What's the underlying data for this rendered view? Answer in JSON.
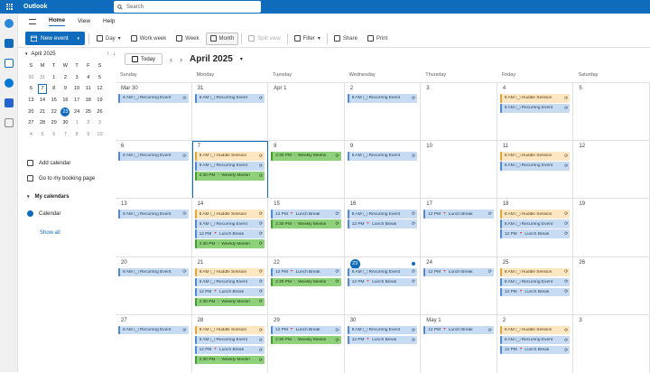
{
  "app": {
    "title": "Outlook",
    "search_placeholder": "Search"
  },
  "ribbon": {
    "tabs": [
      "Home",
      "View",
      "Help"
    ],
    "active": "Home"
  },
  "toolbar": {
    "new_event": "New event",
    "buttons": [
      {
        "label": "Day",
        "icon": "day-icon",
        "state": "normal",
        "name": "day-view-button"
      },
      {
        "label": "Work week",
        "icon": "workweek-icon",
        "state": "normal",
        "name": "workweek-view-button"
      },
      {
        "label": "Week",
        "icon": "week-icon",
        "state": "normal",
        "name": "week-view-button"
      },
      {
        "label": "Month",
        "icon": "month-icon",
        "state": "active",
        "name": "month-view-button"
      },
      {
        "label": "Split view",
        "icon": "split-icon",
        "state": "disabled",
        "name": "split-view-button"
      },
      {
        "label": "Filter",
        "icon": "filter-icon",
        "state": "normal",
        "name": "filter-button"
      },
      {
        "label": "Share",
        "icon": "share-icon",
        "state": "normal",
        "name": "share-button"
      },
      {
        "label": "Print",
        "icon": "print-icon",
        "state": "normal",
        "name": "print-button"
      }
    ]
  },
  "minical": {
    "title": "April 2025",
    "dow": [
      "S",
      "M",
      "T",
      "W",
      "T",
      "F",
      "S"
    ],
    "weeks": [
      [
        "30",
        "31",
        "1",
        "2",
        "3",
        "4",
        "5"
      ],
      [
        "6",
        "7",
        "8",
        "9",
        "10",
        "11",
        "12"
      ],
      [
        "13",
        "14",
        "15",
        "16",
        "17",
        "18",
        "19"
      ],
      [
        "20",
        "21",
        "22",
        "23",
        "24",
        "25",
        "26"
      ],
      [
        "27",
        "28",
        "29",
        "30",
        "1",
        "2",
        "3"
      ],
      [
        "4",
        "5",
        "6",
        "7",
        "8",
        "9",
        "10"
      ]
    ],
    "today": "23",
    "selected": "7"
  },
  "sidebar": {
    "add_calendar": "Add calendar",
    "booking": "Go to my booking page",
    "my_calendars": "My calendars",
    "calendar": "Calendar",
    "show_all": "Show all"
  },
  "calendar": {
    "today_label": "Today",
    "month_title": "April 2025",
    "dow": [
      "Sunday",
      "Monday",
      "Tuesday",
      "Wednesday",
      "Thursday",
      "Friday",
      "Saturday"
    ],
    "weeks": [
      [
        {
          "d": "Mar 30",
          "events": [
            {
              "t": "8 AM",
              "n": "Recurring Event",
              "c": "blue"
            }
          ]
        },
        {
          "d": "31",
          "events": [
            {
              "t": "8 AM",
              "n": "Recurring Event",
              "c": "blue"
            }
          ]
        },
        {
          "d": "Apr 1",
          "events": []
        },
        {
          "d": "2",
          "events": [
            {
              "t": "8 AM",
              "n": "Recurring Event",
              "c": "blue"
            }
          ]
        },
        {
          "d": "3",
          "events": []
        },
        {
          "d": "4",
          "events": [
            {
              "t": "8 AM",
              "n": "Huddle Session",
              "c": "orange"
            },
            {
              "t": "8 AM",
              "n": "Recurring Event",
              "c": "blue"
            }
          ]
        },
        {
          "d": "5",
          "events": []
        }
      ],
      [
        {
          "d": "6",
          "events": [
            {
              "t": "8 AM",
              "n": "Recurring Event",
              "c": "blue"
            }
          ]
        },
        {
          "d": "7",
          "selected": true,
          "events": [
            {
              "t": "8 AM",
              "n": "Huddle Session",
              "c": "orange"
            },
            {
              "t": "8 AM",
              "n": "Recurring Event",
              "c": "blue"
            },
            {
              "t": "2:30 PM",
              "n": "Weekly Meetin",
              "c": "green"
            }
          ]
        },
        {
          "d": "8",
          "events": [
            {
              "t": "2:30 PM",
              "n": "Weekly Meetin",
              "c": "green"
            }
          ]
        },
        {
          "d": "9",
          "events": [
            {
              "t": "8 AM",
              "n": "Recurring Event",
              "c": "blue"
            }
          ]
        },
        {
          "d": "10",
          "events": []
        },
        {
          "d": "11",
          "events": [
            {
              "t": "8 AM",
              "n": "Huddle Session",
              "c": "orange"
            },
            {
              "t": "8 AM",
              "n": "Recurring Event",
              "c": "blue"
            }
          ]
        },
        {
          "d": "12",
          "events": []
        }
      ],
      [
        {
          "d": "13",
          "events": [
            {
              "t": "8 AM",
              "n": "Recurring Event",
              "c": "blue"
            }
          ]
        },
        {
          "d": "14",
          "events": [
            {
              "t": "8 AM",
              "n": "Huddle Session",
              "c": "orange"
            },
            {
              "t": "8 AM",
              "n": "Recurring Event",
              "c": "blue"
            },
            {
              "t": "12 PM",
              "n": "Lunch Break",
              "c": "blue"
            },
            {
              "t": "2:30 PM",
              "n": "Weekly Meetin",
              "c": "green"
            }
          ]
        },
        {
          "d": "15",
          "events": [
            {
              "t": "12 PM",
              "n": "Lunch Break",
              "c": "blue"
            },
            {
              "t": "2:30 PM",
              "n": "Weekly Meetin",
              "c": "green"
            }
          ]
        },
        {
          "d": "16",
          "events": [
            {
              "t": "8 AM",
              "n": "Recurring Event",
              "c": "blue"
            },
            {
              "t": "12 PM",
              "n": "Lunch Break",
              "c": "blue"
            }
          ]
        },
        {
          "d": "17",
          "events": [
            {
              "t": "12 PM",
              "n": "Lunch Break",
              "c": "blue"
            }
          ]
        },
        {
          "d": "18",
          "events": [
            {
              "t": "8 AM",
              "n": "Huddle Session",
              "c": "orange"
            },
            {
              "t": "8 AM",
              "n": "Recurring Event",
              "c": "blue"
            },
            {
              "t": "12 PM",
              "n": "Lunch Break",
              "c": "blue"
            }
          ]
        },
        {
          "d": "19",
          "events": []
        }
      ],
      [
        {
          "d": "20",
          "events": [
            {
              "t": "8 AM",
              "n": "Recurring Event",
              "c": "blue"
            }
          ]
        },
        {
          "d": "21",
          "events": [
            {
              "t": "8 AM",
              "n": "Huddle Session",
              "c": "orange"
            },
            {
              "t": "8 AM",
              "n": "Recurring Event",
              "c": "blue"
            },
            {
              "t": "12 PM",
              "n": "Lunch Break",
              "c": "blue"
            },
            {
              "t": "2:30 PM",
              "n": "Weekly Meetin",
              "c": "green"
            }
          ]
        },
        {
          "d": "22",
          "events": [
            {
              "t": "12 PM",
              "n": "Lunch Break",
              "c": "blue"
            },
            {
              "t": "2:30 PM",
              "n": "Weekly Meetin",
              "c": "green"
            }
          ]
        },
        {
          "d": "23",
          "today": true,
          "events": [
            {
              "t": "8 AM",
              "n": "Recurring Event",
              "c": "blue"
            },
            {
              "t": "12 PM",
              "n": "Lunch Break",
              "c": "blue"
            }
          ]
        },
        {
          "d": "24",
          "events": [
            {
              "t": "12 PM",
              "n": "Lunch Break",
              "c": "blue"
            }
          ]
        },
        {
          "d": "25",
          "events": [
            {
              "t": "8 AM",
              "n": "Huddle Session",
              "c": "orange"
            },
            {
              "t": "8 AM",
              "n": "Recurring Event",
              "c": "blue"
            },
            {
              "t": "12 PM",
              "n": "Lunch Break",
              "c": "blue"
            }
          ]
        },
        {
          "d": "26",
          "events": []
        }
      ],
      [
        {
          "d": "27",
          "events": [
            {
              "t": "8 AM",
              "n": "Recurring Event",
              "c": "blue"
            }
          ]
        },
        {
          "d": "28",
          "events": [
            {
              "t": "8 AM",
              "n": "Huddle Session",
              "c": "orange"
            },
            {
              "t": "8 AM",
              "n": "Recurring Event",
              "c": "blue"
            },
            {
              "t": "12 PM",
              "n": "Lunch Break",
              "c": "blue"
            },
            {
              "t": "2:30 PM",
              "n": "Weekly Meetin",
              "c": "green"
            }
          ]
        },
        {
          "d": "29",
          "events": [
            {
              "t": "12 PM",
              "n": "Lunch Break",
              "c": "blue"
            },
            {
              "t": "2:30 PM",
              "n": "Weekly Meetin",
              "c": "green"
            }
          ]
        },
        {
          "d": "30",
          "events": [
            {
              "t": "8 AM",
              "n": "Recurring Event",
              "c": "blue"
            },
            {
              "t": "12 PM",
              "n": "Lunch Break",
              "c": "blue"
            }
          ]
        },
        {
          "d": "May 1",
          "events": [
            {
              "t": "12 PM",
              "n": "Lunch Break",
              "c": "blue"
            }
          ]
        },
        {
          "d": "2",
          "events": [
            {
              "t": "8 AM",
              "n": "Huddle Session",
              "c": "orange"
            },
            {
              "t": "8 AM",
              "n": "Recurring Event",
              "c": "blue"
            },
            {
              "t": "12 PM",
              "n": "Lunch Break",
              "c": "blue"
            }
          ]
        },
        {
          "d": "3",
          "events": []
        }
      ]
    ]
  },
  "colors": {
    "brand": "#0f6cbd",
    "event_blue": "#c7dcf3",
    "event_orange": "#fde7c2",
    "event_green": "#8fd17a"
  }
}
